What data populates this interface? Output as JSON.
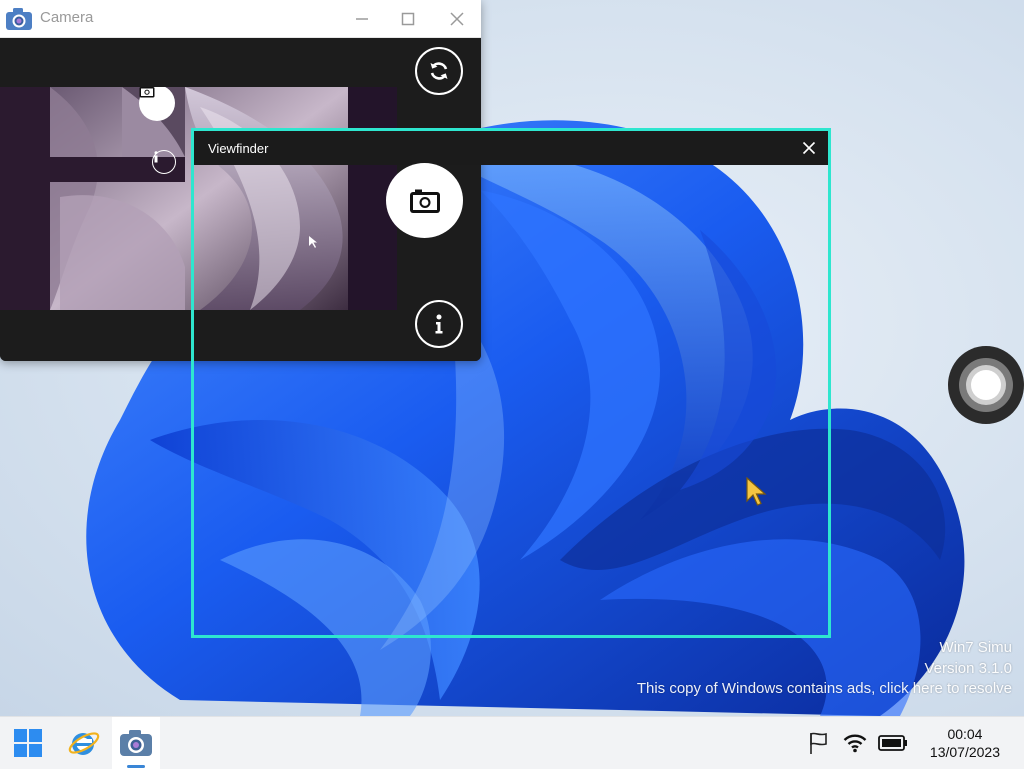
{
  "camera_window": {
    "title": "Camera",
    "title_icon": "camera-icon",
    "controls": [
      "minimize-icon",
      "maximize-icon",
      "close-icon"
    ],
    "buttons": [
      "switch-camera-icon",
      "capture-icon",
      "info-icon"
    ]
  },
  "viewfinder": {
    "title": "Viewfinder",
    "close_icon": "close-icon",
    "border_color": "#2ee6cf"
  },
  "watermark": {
    "line1": "Win7 Simu",
    "line2": "Version 3.1.0",
    "line3": "This copy of Windows contains ads, click here to resolve"
  },
  "taskbar": {
    "start_icon": "windows-start-icon",
    "pinned": [
      "internet-explorer-icon",
      "camera-app-icon"
    ],
    "active_app": "Camera",
    "tray_icons": [
      "flag-icon",
      "wifi-icon",
      "battery-icon"
    ],
    "time": "00:04",
    "date": "13/07/2023",
    "accent_color": "#3a86d6"
  },
  "side_control": {
    "icon": "shutter-icon"
  }
}
